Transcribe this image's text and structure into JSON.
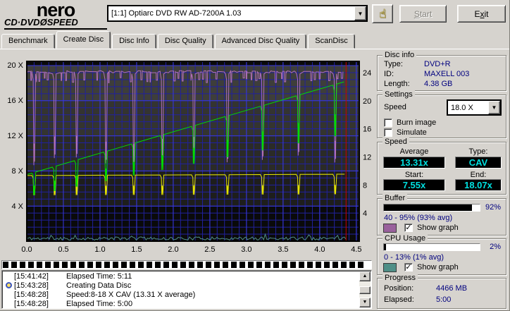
{
  "header": {
    "logo": {
      "name": "nero",
      "sub_left": "CD·DVD",
      "sub_disc": "Ø",
      "sub_right": "SPEED"
    },
    "drive_select": {
      "value": "[1:1]   Optiarc DVD RW AD-7200A 1.03"
    },
    "start_button": {
      "pre": "",
      "key": "S",
      "post": "tart",
      "enabled": false
    },
    "exit_button": {
      "pre": "E",
      "key": "x",
      "post": "it",
      "enabled": true
    }
  },
  "icons": {
    "hand": "☝",
    "dropdown": "▼",
    "scroll_up": "▲",
    "scroll_down": "▼",
    "check": "✓"
  },
  "tabs": [
    "Benchmark",
    "Create Disc",
    "Disc Info",
    "Disc Quality",
    "Advanced Disc Quality",
    "ScanDisc"
  ],
  "active_tab": "Create Disc",
  "disc_info": {
    "title": "Disc info",
    "rows": [
      {
        "label": "Type:",
        "value": "DVD+R"
      },
      {
        "label": "ID:",
        "value": "MAXELL 003"
      },
      {
        "label": "Length:",
        "value": "4.38 GB"
      }
    ]
  },
  "settings": {
    "title": "Settings",
    "speed_label": "Speed",
    "speed_value": "18.0 X",
    "burn_image_label": "Burn image",
    "burn_image_checked": false,
    "simulate_label": "Simulate",
    "simulate_checked": false
  },
  "speed": {
    "title": "Speed",
    "average_label": "Average",
    "average": "13.31x",
    "type_label": "Type:",
    "type": "CAV",
    "start_label": "Start:",
    "start": "7.55x",
    "end_label": "End:",
    "end": "18.07x"
  },
  "buffer": {
    "title": "Buffer",
    "percent": "92%",
    "fill_pct": 92,
    "range": "40 - 95% (93% avg)",
    "show_graph_label": "Show graph",
    "show_graph_checked": true,
    "swatch_color": "#99619c"
  },
  "cpu": {
    "title": "CPU Usage",
    "percent": "2%",
    "fill_pct": 2,
    "range": "0 - 13% (1% avg)",
    "show_graph_label": "Show graph",
    "show_graph_checked": true,
    "swatch_color": "#4f8f87"
  },
  "progress": {
    "title": "Progress",
    "position_label": "Position:",
    "position": "4466 MB",
    "elapsed_label": "Elapsed:",
    "elapsed": "5:00"
  },
  "write_progress": {
    "percent": 100
  },
  "log": {
    "entries": [
      {
        "time": "[15:41:42]",
        "text": "Elapsed Time:  5:11",
        "icon": false
      },
      {
        "time": "[15:43:28]",
        "text": "Creating Data Disc",
        "icon": true
      },
      {
        "time": "[15:48:28]",
        "text": "Speed:8-18 X CAV (13.31 X average)",
        "icon": false
      },
      {
        "time": "[15:48:28]",
        "text": "Elapsed Time:  5:00",
        "icon": false
      }
    ]
  },
  "chart_data": {
    "type": "line",
    "title": "",
    "x_axis": {
      "min": 0,
      "max": 4.54,
      "unit": "GB",
      "ticks": [
        {
          "g": 0.0,
          "label": "0.0"
        },
        {
          "g": 0.5,
          "label": "0.5"
        },
        {
          "g": 1.0,
          "label": "1.0"
        },
        {
          "g": 1.5,
          "label": "1.5"
        },
        {
          "g": 2.0,
          "label": "2.0"
        },
        {
          "g": 2.5,
          "label": "2.5"
        },
        {
          "g": 3.0,
          "label": "3.0"
        },
        {
          "g": 3.5,
          "label": "3.5"
        },
        {
          "g": 4.0,
          "label": "4.0"
        },
        {
          "g": 4.5,
          "label": "4.5"
        }
      ]
    },
    "left_axis": {
      "min": 0,
      "max": 20.4,
      "unit": "X",
      "ticks": [
        {
          "v": 20,
          "label": "20 X"
        },
        {
          "v": 16,
          "label": "16 X"
        },
        {
          "v": 12,
          "label": "12 X"
        },
        {
          "v": 8,
          "label": "8 X"
        },
        {
          "v": 4,
          "label": "4 X"
        }
      ]
    },
    "right_axis": {
      "min": 0,
      "max": 25.6,
      "ticks": [
        {
          "u": 24,
          "label": "24"
        },
        {
          "u": 20,
          "label": "20"
        },
        {
          "u": 16,
          "label": "16"
        },
        {
          "u": 12,
          "label": "12"
        },
        {
          "u": 8,
          "label": "8"
        },
        {
          "u": 4,
          "label": "4"
        }
      ]
    },
    "grid": {
      "minor_color": "#21219e",
      "major_color": "#3939e0",
      "h_minor_step_u": 1,
      "h_major_step_u": 5,
      "v_minor_step": 0.1,
      "v_major_step": 0.5
    },
    "bands": [
      {
        "from_u": 25.6,
        "to_u": 25,
        "color": "#0a0a0a"
      },
      {
        "from_u": 25,
        "to_u": 20,
        "color": "#3e3e3a"
      },
      {
        "from_u": 20,
        "to_u": 15,
        "color": "#343430"
      },
      {
        "from_u": 15,
        "to_u": 10,
        "color": "#2b2b27"
      },
      {
        "from_u": 10,
        "to_u": 5,
        "color": "#1e1e1c"
      },
      {
        "from_u": 5,
        "to_u": 0,
        "color": "#0a0a0a"
      }
    ],
    "dip_positions": [
      0.1,
      0.38,
      0.68,
      1.08,
      1.46,
      1.85,
      2.28,
      2.74,
      3.22,
      3.71,
      4.21
    ],
    "series": [
      {
        "name": "cpu-usage",
        "color": "#4f8f87",
        "scale": "pct",
        "type": "noise",
        "base_pct": 1,
        "max_pct": 4,
        "x_end": 4.36,
        "seed": 11
      },
      {
        "name": "buffer-level",
        "color": "#b070b8",
        "scale": "pct",
        "type": "buffer",
        "base_pct": 94,
        "wiggle_low_pct": 89,
        "deep_dip_pct": 42,
        "x_end": 4.36,
        "seed": 7
      },
      {
        "name": "rotation-speed",
        "color": "#e6e600",
        "scale": "x",
        "type": "flat_dips",
        "start": 7.45,
        "end": 7.6,
        "dip_factor": 0.7,
        "x_end": 4.34
      },
      {
        "name": "write-speed",
        "color": "#00dd00",
        "scale": "x",
        "type": "trend_dips",
        "start": 7.55,
        "end": 18.07,
        "dip_factor": 0.67,
        "x_end": 4.33
      }
    ],
    "marker": {
      "x": 4.36,
      "color": "#cc0000"
    }
  }
}
